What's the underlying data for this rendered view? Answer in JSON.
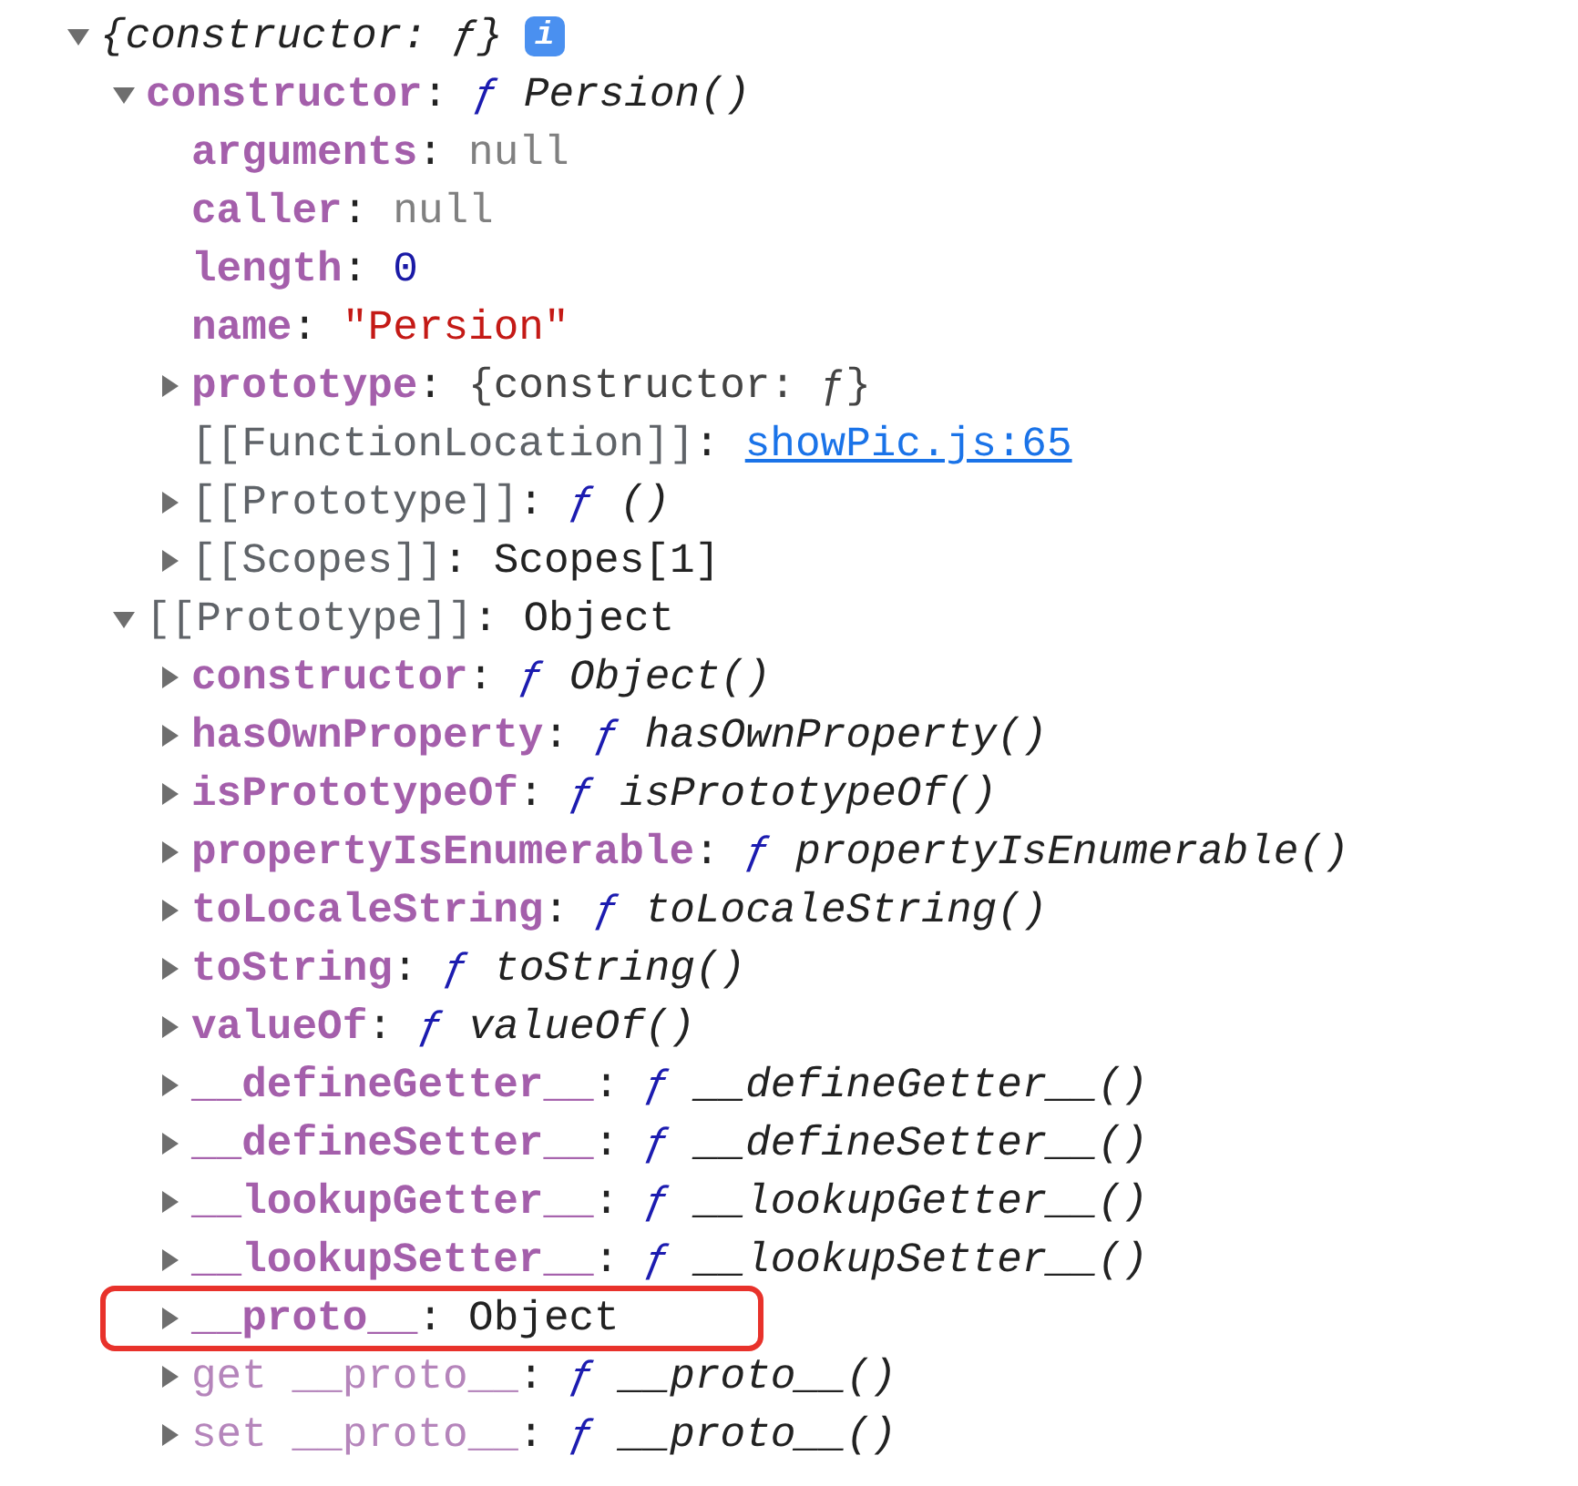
{
  "separator": ":",
  "tree": [
    {
      "summary": "{constructor: ƒ}",
      "badge": "i",
      "expandable": true,
      "expanded": true,
      "children": [
        {
          "key": "constructor",
          "kind": "own",
          "value": {
            "kind": "function",
            "symbol": "ƒ",
            "name": "Persion()"
          },
          "expandable": true,
          "expanded": true,
          "children": [
            {
              "key": "arguments",
              "kind": "own",
              "value": {
                "kind": "null",
                "text": "null"
              },
              "expandable": false
            },
            {
              "key": "caller",
              "kind": "own",
              "value": {
                "kind": "null",
                "text": "null"
              },
              "expandable": false
            },
            {
              "key": "length",
              "kind": "own",
              "value": {
                "kind": "number",
                "text": "0"
              },
              "expandable": false
            },
            {
              "key": "name",
              "kind": "own",
              "value": {
                "kind": "string",
                "text": "\"Persion\""
              },
              "expandable": false
            },
            {
              "key": "prototype",
              "kind": "own",
              "value": {
                "kind": "preview",
                "text": "{constructor: ƒ}"
              },
              "expandable": true,
              "expanded": false
            },
            {
              "key": "[[FunctionLocation]]",
              "kind": "internal",
              "value": {
                "kind": "link",
                "text": "showPic.js:65"
              },
              "expandable": false
            },
            {
              "key": "[[Prototype]]",
              "kind": "internal",
              "value": {
                "kind": "function",
                "symbol": "ƒ",
                "name": "()"
              },
              "expandable": true,
              "expanded": false
            },
            {
              "key": "[[Scopes]]",
              "kind": "internal",
              "value": {
                "kind": "object",
                "text": "Scopes[1]"
              },
              "expandable": true,
              "expanded": false
            }
          ]
        },
        {
          "key": "[[Prototype]]",
          "kind": "internal",
          "value": {
            "kind": "object",
            "text": "Object"
          },
          "expandable": true,
          "expanded": true,
          "children": [
            {
              "key": "constructor",
              "kind": "own",
              "value": {
                "kind": "function",
                "symbol": "ƒ",
                "name": "Object()"
              },
              "expandable": true,
              "expanded": false
            },
            {
              "key": "hasOwnProperty",
              "kind": "own",
              "value": {
                "kind": "function",
                "symbol": "ƒ",
                "name": "hasOwnProperty()"
              },
              "expandable": true,
              "expanded": false
            },
            {
              "key": "isPrototypeOf",
              "kind": "own",
              "value": {
                "kind": "function",
                "symbol": "ƒ",
                "name": "isPrototypeOf()"
              },
              "expandable": true,
              "expanded": false
            },
            {
              "key": "propertyIsEnumerable",
              "kind": "own",
              "value": {
                "kind": "function",
                "symbol": "ƒ",
                "name": "propertyIsEnumerable()"
              },
              "expandable": true,
              "expanded": false
            },
            {
              "key": "toLocaleString",
              "kind": "own",
              "value": {
                "kind": "function",
                "symbol": "ƒ",
                "name": "toLocaleString()"
              },
              "expandable": true,
              "expanded": false
            },
            {
              "key": "toString",
              "kind": "own",
              "value": {
                "kind": "function",
                "symbol": "ƒ",
                "name": "toString()"
              },
              "expandable": true,
              "expanded": false
            },
            {
              "key": "valueOf",
              "kind": "own",
              "value": {
                "kind": "function",
                "symbol": "ƒ",
                "name": "valueOf()"
              },
              "expandable": true,
              "expanded": false
            },
            {
              "key": "__defineGetter__",
              "kind": "own",
              "value": {
                "kind": "function",
                "symbol": "ƒ",
                "name": "__defineGetter__()"
              },
              "expandable": true,
              "expanded": false
            },
            {
              "key": "__defineSetter__",
              "kind": "own",
              "value": {
                "kind": "function",
                "symbol": "ƒ",
                "name": "__defineSetter__()"
              },
              "expandable": true,
              "expanded": false
            },
            {
              "key": "__lookupGetter__",
              "kind": "own",
              "value": {
                "kind": "function",
                "symbol": "ƒ",
                "name": "__lookupGetter__()"
              },
              "expandable": true,
              "expanded": false
            },
            {
              "key": "__lookupSetter__",
              "kind": "own",
              "value": {
                "kind": "function",
                "symbol": "ƒ",
                "name": "__lookupSetter__()"
              },
              "expandable": true,
              "expanded": false
            },
            {
              "key": "__proto__",
              "kind": "own",
              "value": {
                "kind": "object",
                "text": "Object"
              },
              "expandable": true,
              "expanded": false,
              "highlighted": true
            },
            {
              "key": "get __proto__",
              "kind": "accessor",
              "value": {
                "kind": "function",
                "symbol": "ƒ",
                "name": "__proto__()"
              },
              "expandable": true,
              "expanded": false
            },
            {
              "key": "set __proto__",
              "kind": "accessor",
              "value": {
                "kind": "function",
                "symbol": "ƒ",
                "name": "__proto__()"
              },
              "expandable": true,
              "expanded": false
            }
          ]
        }
      ]
    }
  ]
}
